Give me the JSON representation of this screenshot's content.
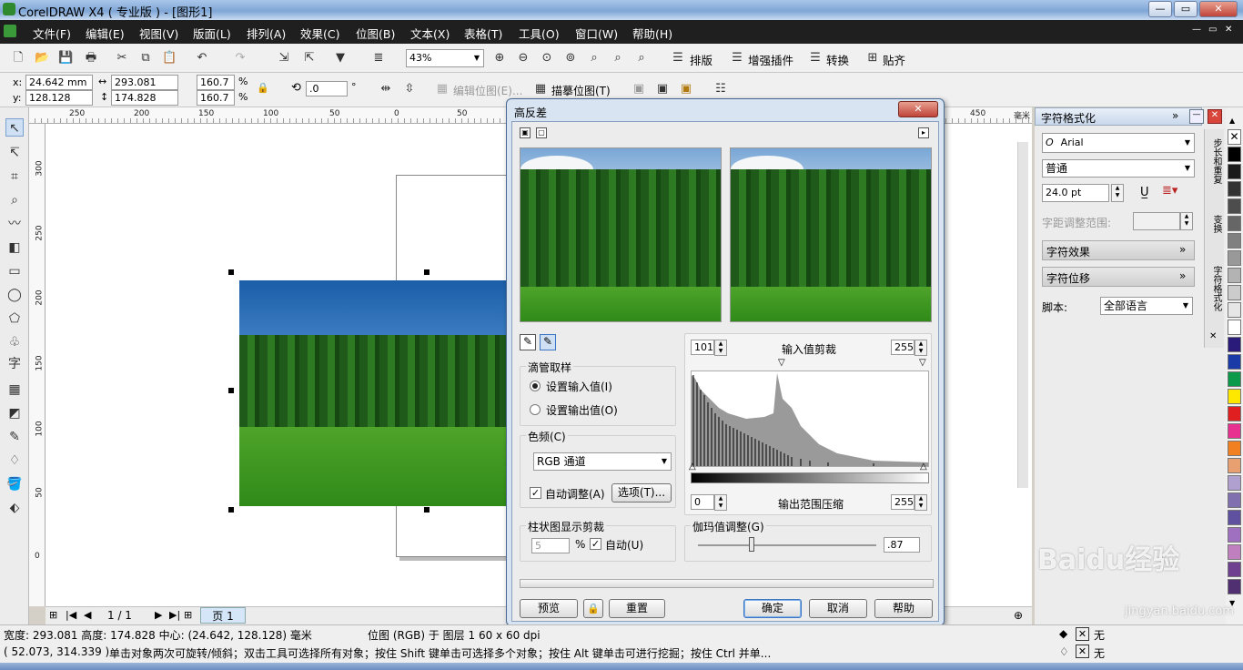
{
  "window": {
    "title": "CorelDRAW X4 ( 专业版 ) - [图形1]"
  },
  "menu": [
    "文件(F)",
    "编辑(E)",
    "视图(V)",
    "版面(L)",
    "排列(A)",
    "效果(C)",
    "位图(B)",
    "文本(X)",
    "表格(T)",
    "工具(O)",
    "窗口(W)",
    "帮助(H)"
  ],
  "toolbar": {
    "zoom": "43%",
    "btn_paiban": "排版",
    "btn_plugin": "增强插件",
    "btn_convert": "转换",
    "btn_paste": "贴齐"
  },
  "propbar": {
    "x": "24.642 mm",
    "y": "128.128 mm",
    "w": "293.081 mm",
    "h": "174.828 mm",
    "sx": "160.7",
    "sy": "160.7",
    "pct": "%",
    "rot": ".0",
    "deg": "°",
    "edit_bitmap": "编辑位图(E)...",
    "trace_bitmap": "描摹位图(T)"
  },
  "ruler_h": [
    "250",
    "200",
    "150",
    "100",
    "50",
    "0",
    "50",
    "450",
    "毫米"
  ],
  "ruler_v": [
    "300",
    "250",
    "200",
    "150",
    "100",
    "50",
    "0"
  ],
  "dialog": {
    "title": "高反差",
    "dropper_group": "滴管取样",
    "radio_input": "设置输入值(I)",
    "radio_output": "设置输出值(O)",
    "channel_label": "色频(C)",
    "channel_value": "RGB 通道",
    "auto_adjust": "自动调整(A)",
    "options_btn": "选项(T)...",
    "input_min": "101",
    "input_label": "输入值剪裁",
    "input_max": "255",
    "output_min": "0",
    "output_label": "输出范围压缩",
    "output_max": "255",
    "hist_clip_label": "柱状图显示剪裁",
    "hist_clip_value": "5",
    "hist_clip_pct": "%",
    "hist_auto": "自动(U)",
    "gamma_label": "伽玛值调整(G)",
    "gamma_value": ".87",
    "gamma_level": 0.3,
    "btn_preview": "预览",
    "btn_reset": "重置",
    "btn_ok": "确定",
    "btn_cancel": "取消",
    "btn_help": "帮助"
  },
  "right_panel": {
    "title": "字符格式化",
    "font": "Arial",
    "style": "普通",
    "size": "24.0 pt",
    "spacing_label": "字距调整范围:",
    "effects": "字符效果",
    "shift": "字符位移",
    "script_label": "脚本:",
    "script_value": "全部语言",
    "side_tabs": [
      "步长和重复",
      "变换",
      "字符格式化"
    ]
  },
  "page_nav": {
    "pages": "1 / 1",
    "tab": "页 1"
  },
  "status": {
    "line1": "宽度: 293.081 高度: 174.828 中心: (24.642, 128.128) 毫米",
    "layer": "位图 (RGB) 于 图层 1 60 x 60 dpi",
    "coords": "( 52.073, 314.339 )",
    "hint": "单击对象两次可旋转/倾斜；双击工具可选择所有对象；按住 Shift 键单击可选择多个对象；按住 Alt 键单击可进行挖掘；按住 Ctrl 并单...",
    "fill": "无",
    "outline": "无"
  },
  "watermark": {
    "brand": "Baidu经验",
    "url": "jingyan.baidu.com"
  },
  "colors": {
    "accent": "#3a76c4",
    "menubar": "#1f1f1f"
  }
}
